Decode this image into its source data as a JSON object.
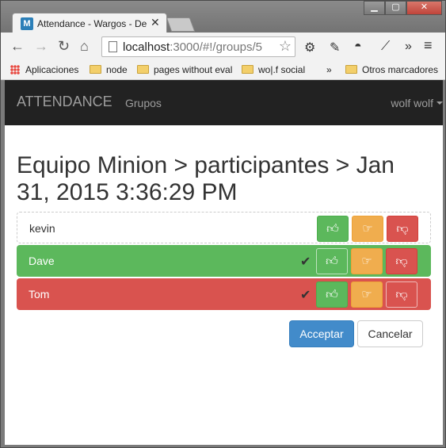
{
  "browser": {
    "tab_title": "Attendance - Wargos - De",
    "tab_favicon": "M",
    "url_host": "localhost",
    "url_rest": ":3000/#!/groups/5",
    "window_controls": [
      "minimize-icon",
      "maximize-icon",
      "close-icon"
    ],
    "bookmarks": [
      {
        "label": "Aplicaciones",
        "icon": "apps-grid-icon"
      },
      {
        "label": "node",
        "icon": "folder-icon"
      },
      {
        "label": "pages without eval",
        "icon": "folder-icon"
      },
      {
        "label": "wo|.f social",
        "icon": "folder-icon"
      },
      {
        "label": "Otros marcadores",
        "icon": "folder-icon"
      }
    ],
    "bookmarks_overflow": "»",
    "extensions_overflow": "»"
  },
  "navbar": {
    "brand": "ATTENDANCE",
    "link": "Grupos",
    "user": "wolf wolf"
  },
  "heading": "Equipo Minion > participantes > Jan 31, 2015 3:36:29 PM",
  "participants": [
    {
      "name": "kevin",
      "status": "none"
    },
    {
      "name": "Dave",
      "status": "present"
    },
    {
      "name": "Tom",
      "status": "absent"
    }
  ],
  "vote_icons": {
    "yes": "thumbs-up-icon",
    "late": "hand-point-right-icon",
    "no": "thumbs-down-icon"
  },
  "actions": {
    "accept": "Acceptar",
    "cancel": "Cancelar"
  },
  "colors": {
    "present": "#5cb85c",
    "late": "#f0ad4e",
    "absent": "#d9534f",
    "primary": "#428bca",
    "navbar": "#222222"
  }
}
